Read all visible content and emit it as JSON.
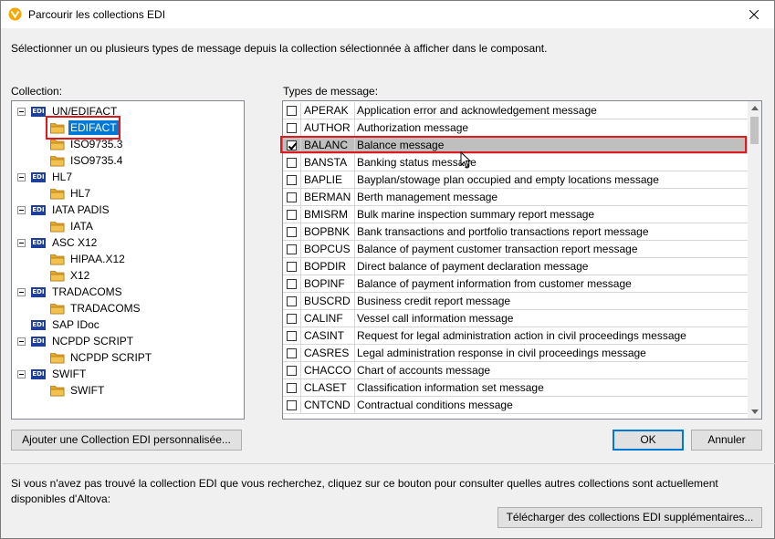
{
  "window": {
    "title": "Parcourir les collections EDI",
    "instruction": "Sélectionner un ou plusieurs types de message depuis la collection sélectionnée à afficher dans le composant."
  },
  "collection": {
    "label": "Collection:",
    "tree": [
      {
        "label": "UN/EDIFACT",
        "kind": "edi",
        "level": 0,
        "expanded": true
      },
      {
        "label": "EDIFACT",
        "kind": "folder",
        "level": 1,
        "selected": true
      },
      {
        "label": "ISO9735.3",
        "kind": "folder",
        "level": 1
      },
      {
        "label": "ISO9735.4",
        "kind": "folder",
        "level": 1
      },
      {
        "label": "HL7",
        "kind": "edi",
        "level": 0,
        "expanded": true
      },
      {
        "label": "HL7",
        "kind": "folder",
        "level": 1
      },
      {
        "label": "IATA PADIS",
        "kind": "edi",
        "level": 0,
        "expanded": true
      },
      {
        "label": "IATA",
        "kind": "folder",
        "level": 1
      },
      {
        "label": "ASC X12",
        "kind": "edi",
        "level": 0,
        "expanded": true
      },
      {
        "label": "HIPAA.X12",
        "kind": "folder",
        "level": 1
      },
      {
        "label": "X12",
        "kind": "folder",
        "level": 1
      },
      {
        "label": "TRADACOMS",
        "kind": "edi",
        "level": 0,
        "expanded": true
      },
      {
        "label": "TRADACOMS",
        "kind": "folder",
        "level": 1
      },
      {
        "label": "SAP IDoc",
        "kind": "edi",
        "level": 0,
        "expanded": false,
        "leaf": true
      },
      {
        "label": "NCPDP SCRIPT",
        "kind": "edi",
        "level": 0,
        "expanded": true
      },
      {
        "label": "NCPDP SCRIPT",
        "kind": "folder",
        "level": 1
      },
      {
        "label": "SWIFT",
        "kind": "edi",
        "level": 0,
        "expanded": true
      },
      {
        "label": "SWIFT",
        "kind": "folder",
        "level": 1
      }
    ]
  },
  "message_types": {
    "label": "Types de message:",
    "rows": [
      {
        "code": "APERAK",
        "desc": "Application error and acknowledgement message",
        "checked": false
      },
      {
        "code": "AUTHOR",
        "desc": "Authorization message",
        "checked": false
      },
      {
        "code": "BALANC",
        "desc": "Balance message",
        "checked": true
      },
      {
        "code": "BANSTA",
        "desc": "Banking status message",
        "checked": false
      },
      {
        "code": "BAPLIE",
        "desc": "Bayplan/stowage plan occupied and empty locations message",
        "checked": false
      },
      {
        "code": "BERMAN",
        "desc": "Berth management message",
        "checked": false
      },
      {
        "code": "BMISRM",
        "desc": "Bulk marine inspection summary report message",
        "checked": false
      },
      {
        "code": "BOPBNK",
        "desc": "Bank transactions and portfolio transactions report message",
        "checked": false
      },
      {
        "code": "BOPCUS",
        "desc": "Balance of payment customer transaction report message",
        "checked": false
      },
      {
        "code": "BOPDIR",
        "desc": "Direct balance of payment declaration message",
        "checked": false
      },
      {
        "code": "BOPINF",
        "desc": "Balance of payment information from customer message",
        "checked": false
      },
      {
        "code": "BUSCRD",
        "desc": "Business credit report message",
        "checked": false
      },
      {
        "code": "CALINF",
        "desc": "Vessel call information message",
        "checked": false
      },
      {
        "code": "CASINT",
        "desc": "Request for legal administration action in civil proceedings message",
        "checked": false
      },
      {
        "code": "CASRES",
        "desc": "Legal administration response in civil proceedings message",
        "checked": false
      },
      {
        "code": "CHACCO",
        "desc": "Chart of accounts message",
        "checked": false
      },
      {
        "code": "CLASET",
        "desc": "Classification information set message",
        "checked": false
      },
      {
        "code": "CNTCND",
        "desc": "Contractual conditions message",
        "checked": false
      }
    ]
  },
  "buttons": {
    "add_collection": "Ajouter une Collection EDI personnalisée...",
    "ok": "OK",
    "cancel": "Annuler",
    "download": "Télécharger des collections EDI supplémentaires..."
  },
  "footer": {
    "text": "Si vous n'avez pas trouvé la collection EDI que vous recherchez, cliquez sur ce bouton pour consulter quelles autres collections sont actuellement disponibles d'Altova:"
  },
  "colors": {
    "accent": "#0078d7",
    "highlight_red": "#e0191e",
    "edi_badge": "#1f3e97",
    "folder": "#f2c14e"
  },
  "icons": {
    "edi_badge_text": "EDI"
  }
}
